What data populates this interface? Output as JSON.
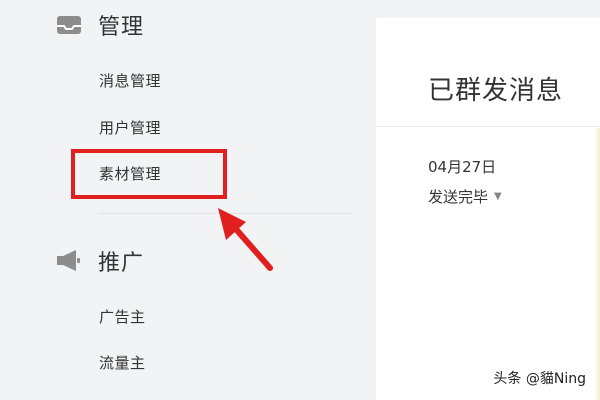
{
  "sidebar": {
    "sections": [
      {
        "label": "管理",
        "icon": "inbox-icon",
        "items": [
          {
            "label": "消息管理"
          },
          {
            "label": "用户管理"
          },
          {
            "label": "素材管理"
          }
        ]
      },
      {
        "label": "推广",
        "icon": "megaphone-icon",
        "items": [
          {
            "label": "广告主"
          },
          {
            "label": "流量主"
          }
        ]
      }
    ]
  },
  "main": {
    "title": "已群发消息",
    "entry": {
      "date": "04月27日",
      "status": "发送完毕"
    }
  },
  "annotation": {
    "highlight_color": "#e02020"
  },
  "watermark": "头条 @貓Ning"
}
